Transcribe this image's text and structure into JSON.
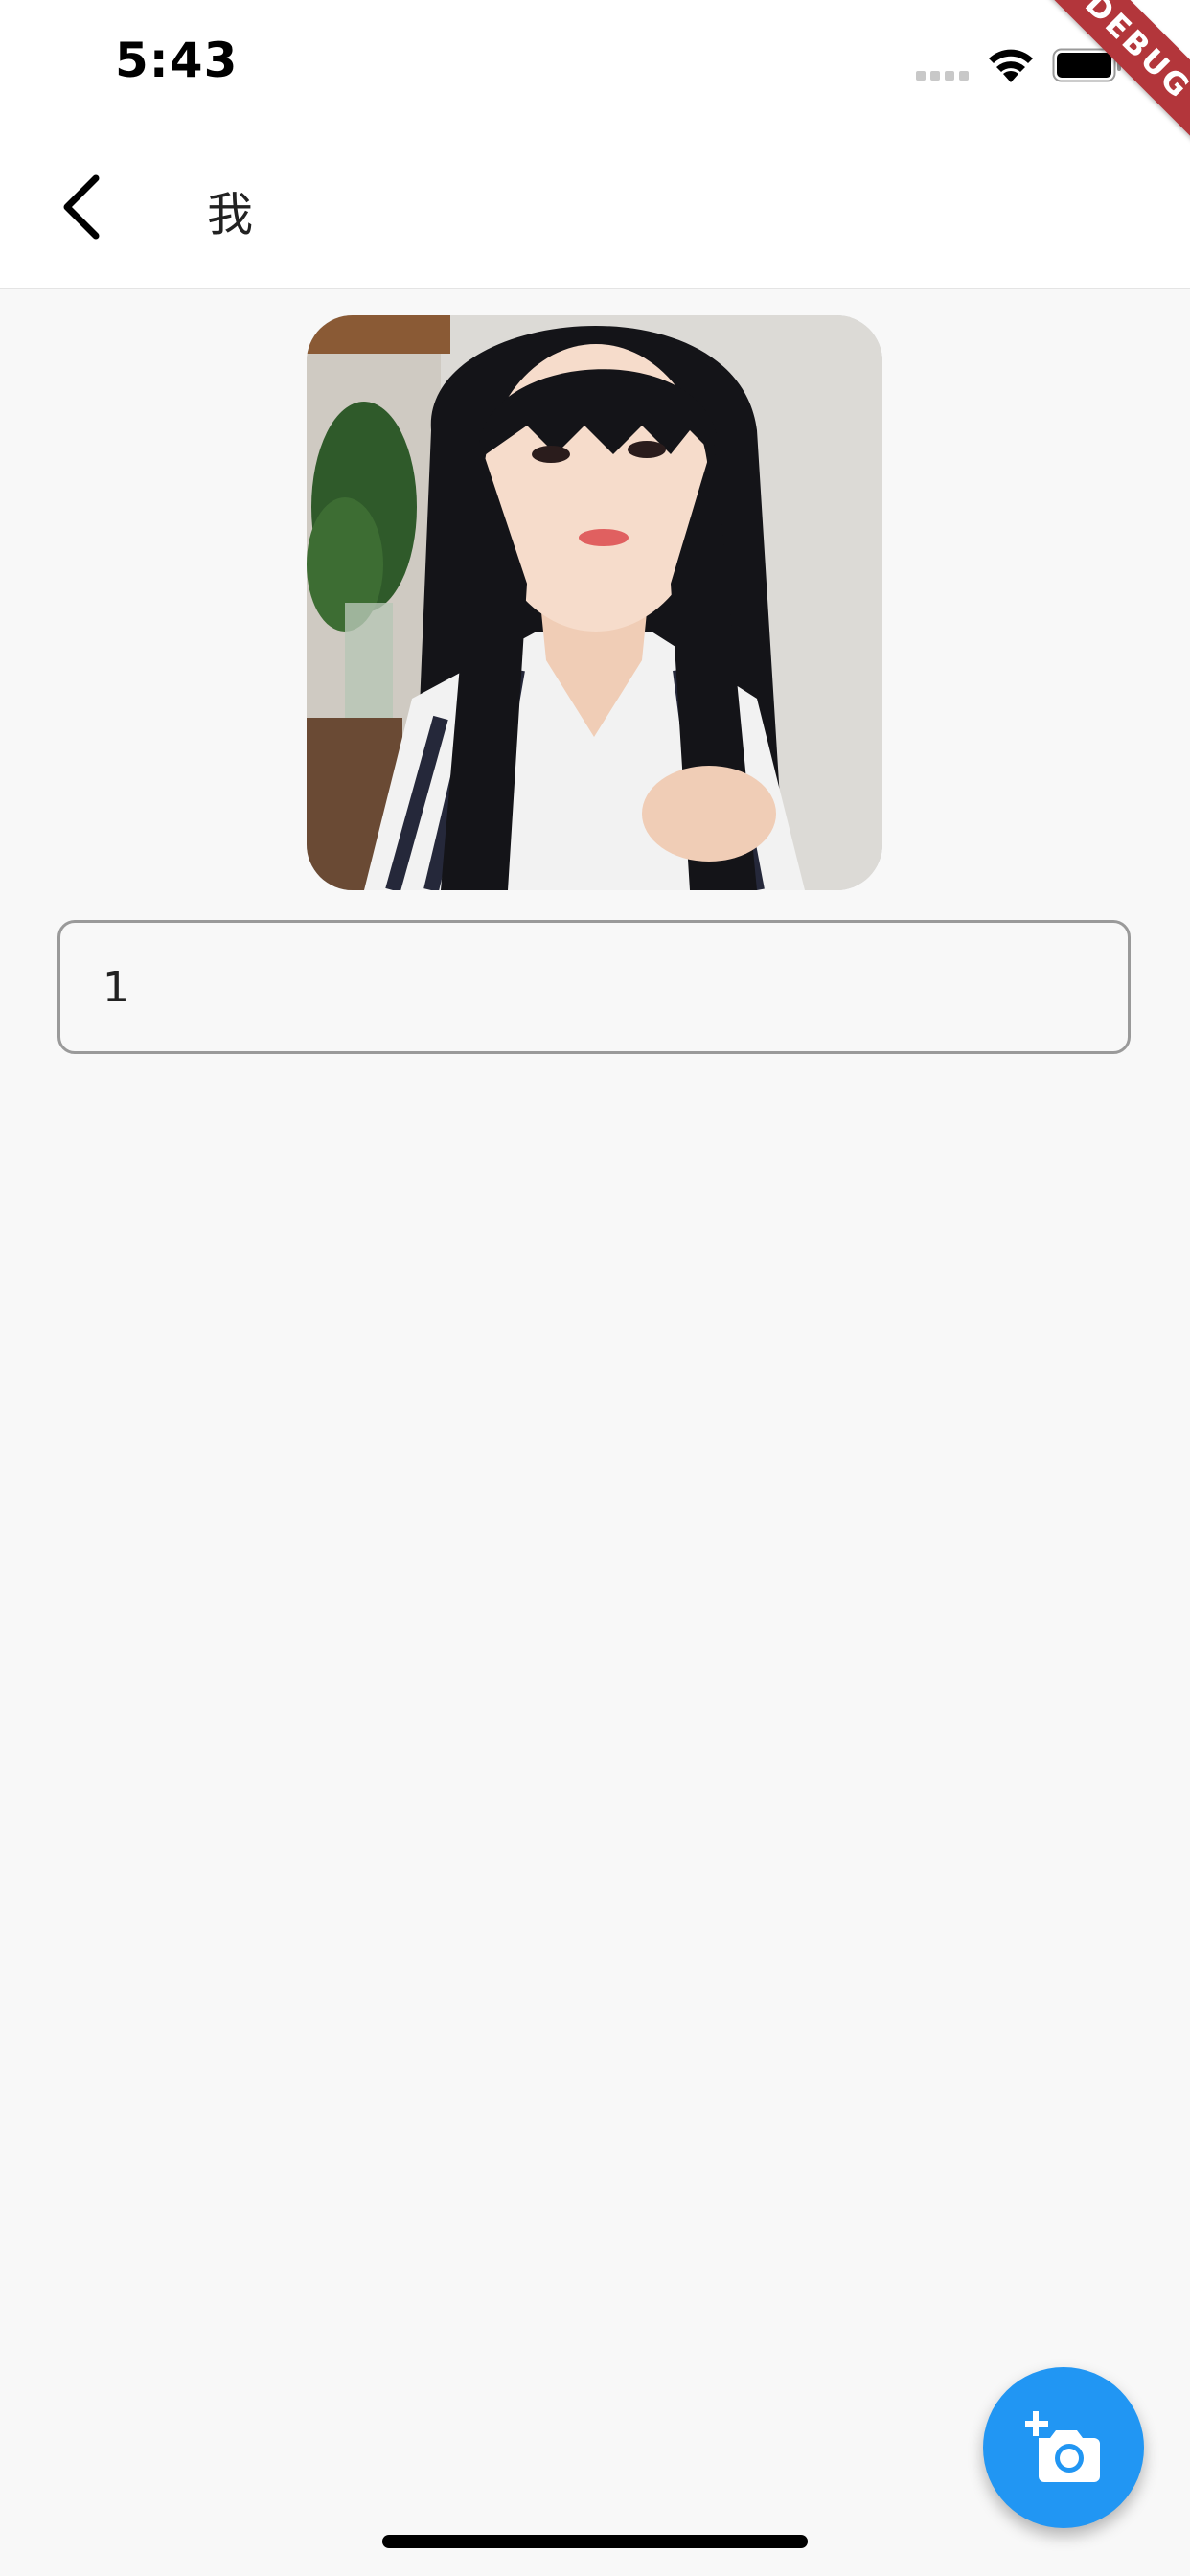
{
  "status_bar": {
    "time": "5:43",
    "cell_icon": "cellular-dots-icon",
    "wifi_icon": "wifi-icon",
    "battery_icon": "battery-icon"
  },
  "debug_banner": {
    "label": "DEBUG",
    "color": "#b3363b"
  },
  "app_bar": {
    "back_icon": "chevron-left-icon",
    "title": "我"
  },
  "profile": {
    "avatar_alt": "profile-photo"
  },
  "text_field": {
    "value": "1"
  },
  "fab": {
    "icon": "add-a-photo-icon",
    "color": "#2196f3"
  }
}
